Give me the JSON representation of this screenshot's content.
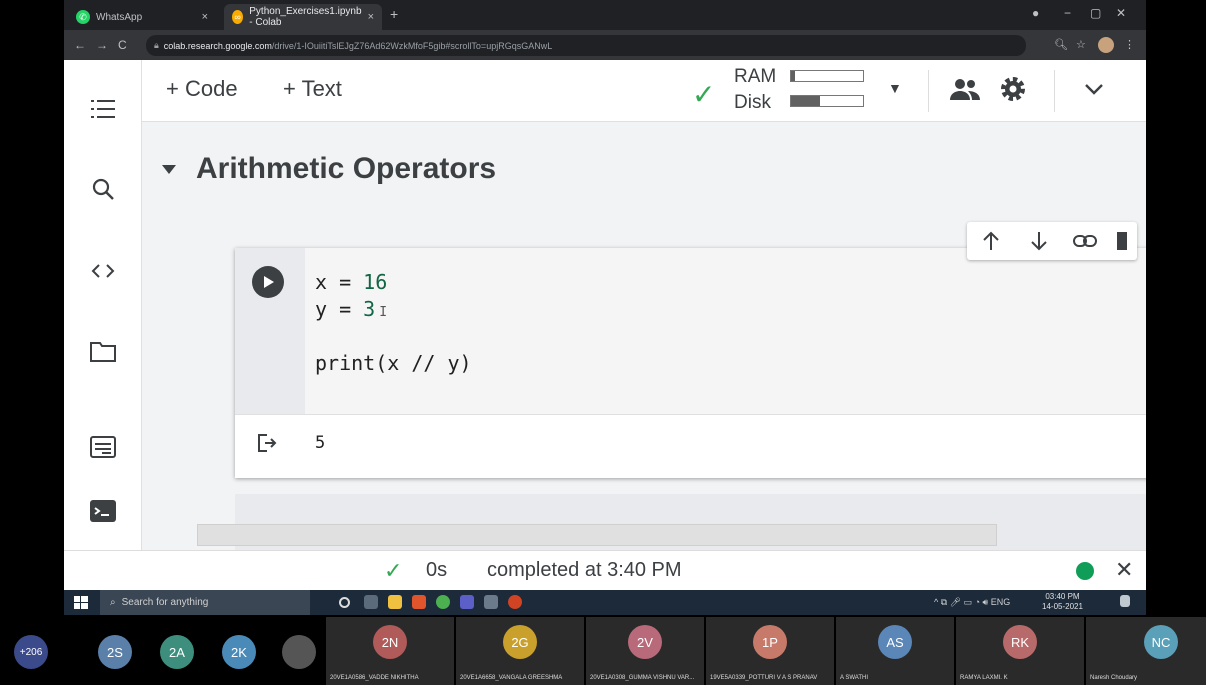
{
  "browser": {
    "tabs": [
      {
        "title": "WhatsApp"
      },
      {
        "title": "Python_Exercises1.ipynb - Colab"
      }
    ],
    "url_host": "colab.research.google.com",
    "url_path": "/drive/1-IOuiitiTslEJgZ76Ad62WzkMfoF5gib#scrollTo=upjRGqsGANwL"
  },
  "toolbar": {
    "add_code": "+ Code",
    "add_text": "+ Text",
    "ram_label": "RAM",
    "disk_label": "Disk",
    "ram_usage": 0.05,
    "disk_usage": 0.4
  },
  "notebook": {
    "section_title": "Arithmetic Operators",
    "code_lines": [
      "x = 16",
      "y = 3",
      "",
      "print(x // y)"
    ],
    "code": {
      "line1_var": "x",
      "line1_op": " = ",
      "line1_num": "16",
      "line2_var": "y",
      "line2_op": " = ",
      "line2_num": "3",
      "line4": "print(x // y)"
    },
    "output": "5",
    "cursor": "I"
  },
  "status": {
    "duration": "0s",
    "message": "completed at 3:40 PM"
  },
  "taskbar": {
    "search_placeholder": "Search for anything",
    "lang": "ENG",
    "time": "03:40 PM",
    "date": "14-05-2021"
  },
  "participants": [
    {
      "initials": "+206",
      "name": "",
      "color": "#3b4a8a"
    },
    {
      "initials": "2S",
      "name": "",
      "color": "#5a7fa8"
    },
    {
      "initials": "2A",
      "name": "",
      "color": "#3e8e7e"
    },
    {
      "initials": "2K",
      "name": "",
      "color": "#4a8ab8"
    },
    {
      "initials": "",
      "name": "",
      "color": "#555555"
    },
    {
      "initials": "2N",
      "name": "20VE1A0586_VADDE NIKHITHA",
      "color": "#b05a5a"
    },
    {
      "initials": "2G",
      "name": "20VE1A6658_VANGALA GREESHMA",
      "color": "#c9a02c"
    },
    {
      "initials": "2V",
      "name": "20VE1A0308_GUMMA VISHNU VAR...",
      "color": "#b86a7a"
    },
    {
      "initials": "1P",
      "name": "19VE5A0339_POTTURI V A S PRANAV",
      "color": "#c77a6a"
    },
    {
      "initials": "AS",
      "name": "A SWATHI",
      "color": "#5a86b8"
    },
    {
      "initials": "RK",
      "name": "RAMYA LAXMI. K",
      "color": "#b86a6a"
    },
    {
      "initials": "NC",
      "name": "Naresh Choudary",
      "color": "#5aa0b8"
    }
  ]
}
